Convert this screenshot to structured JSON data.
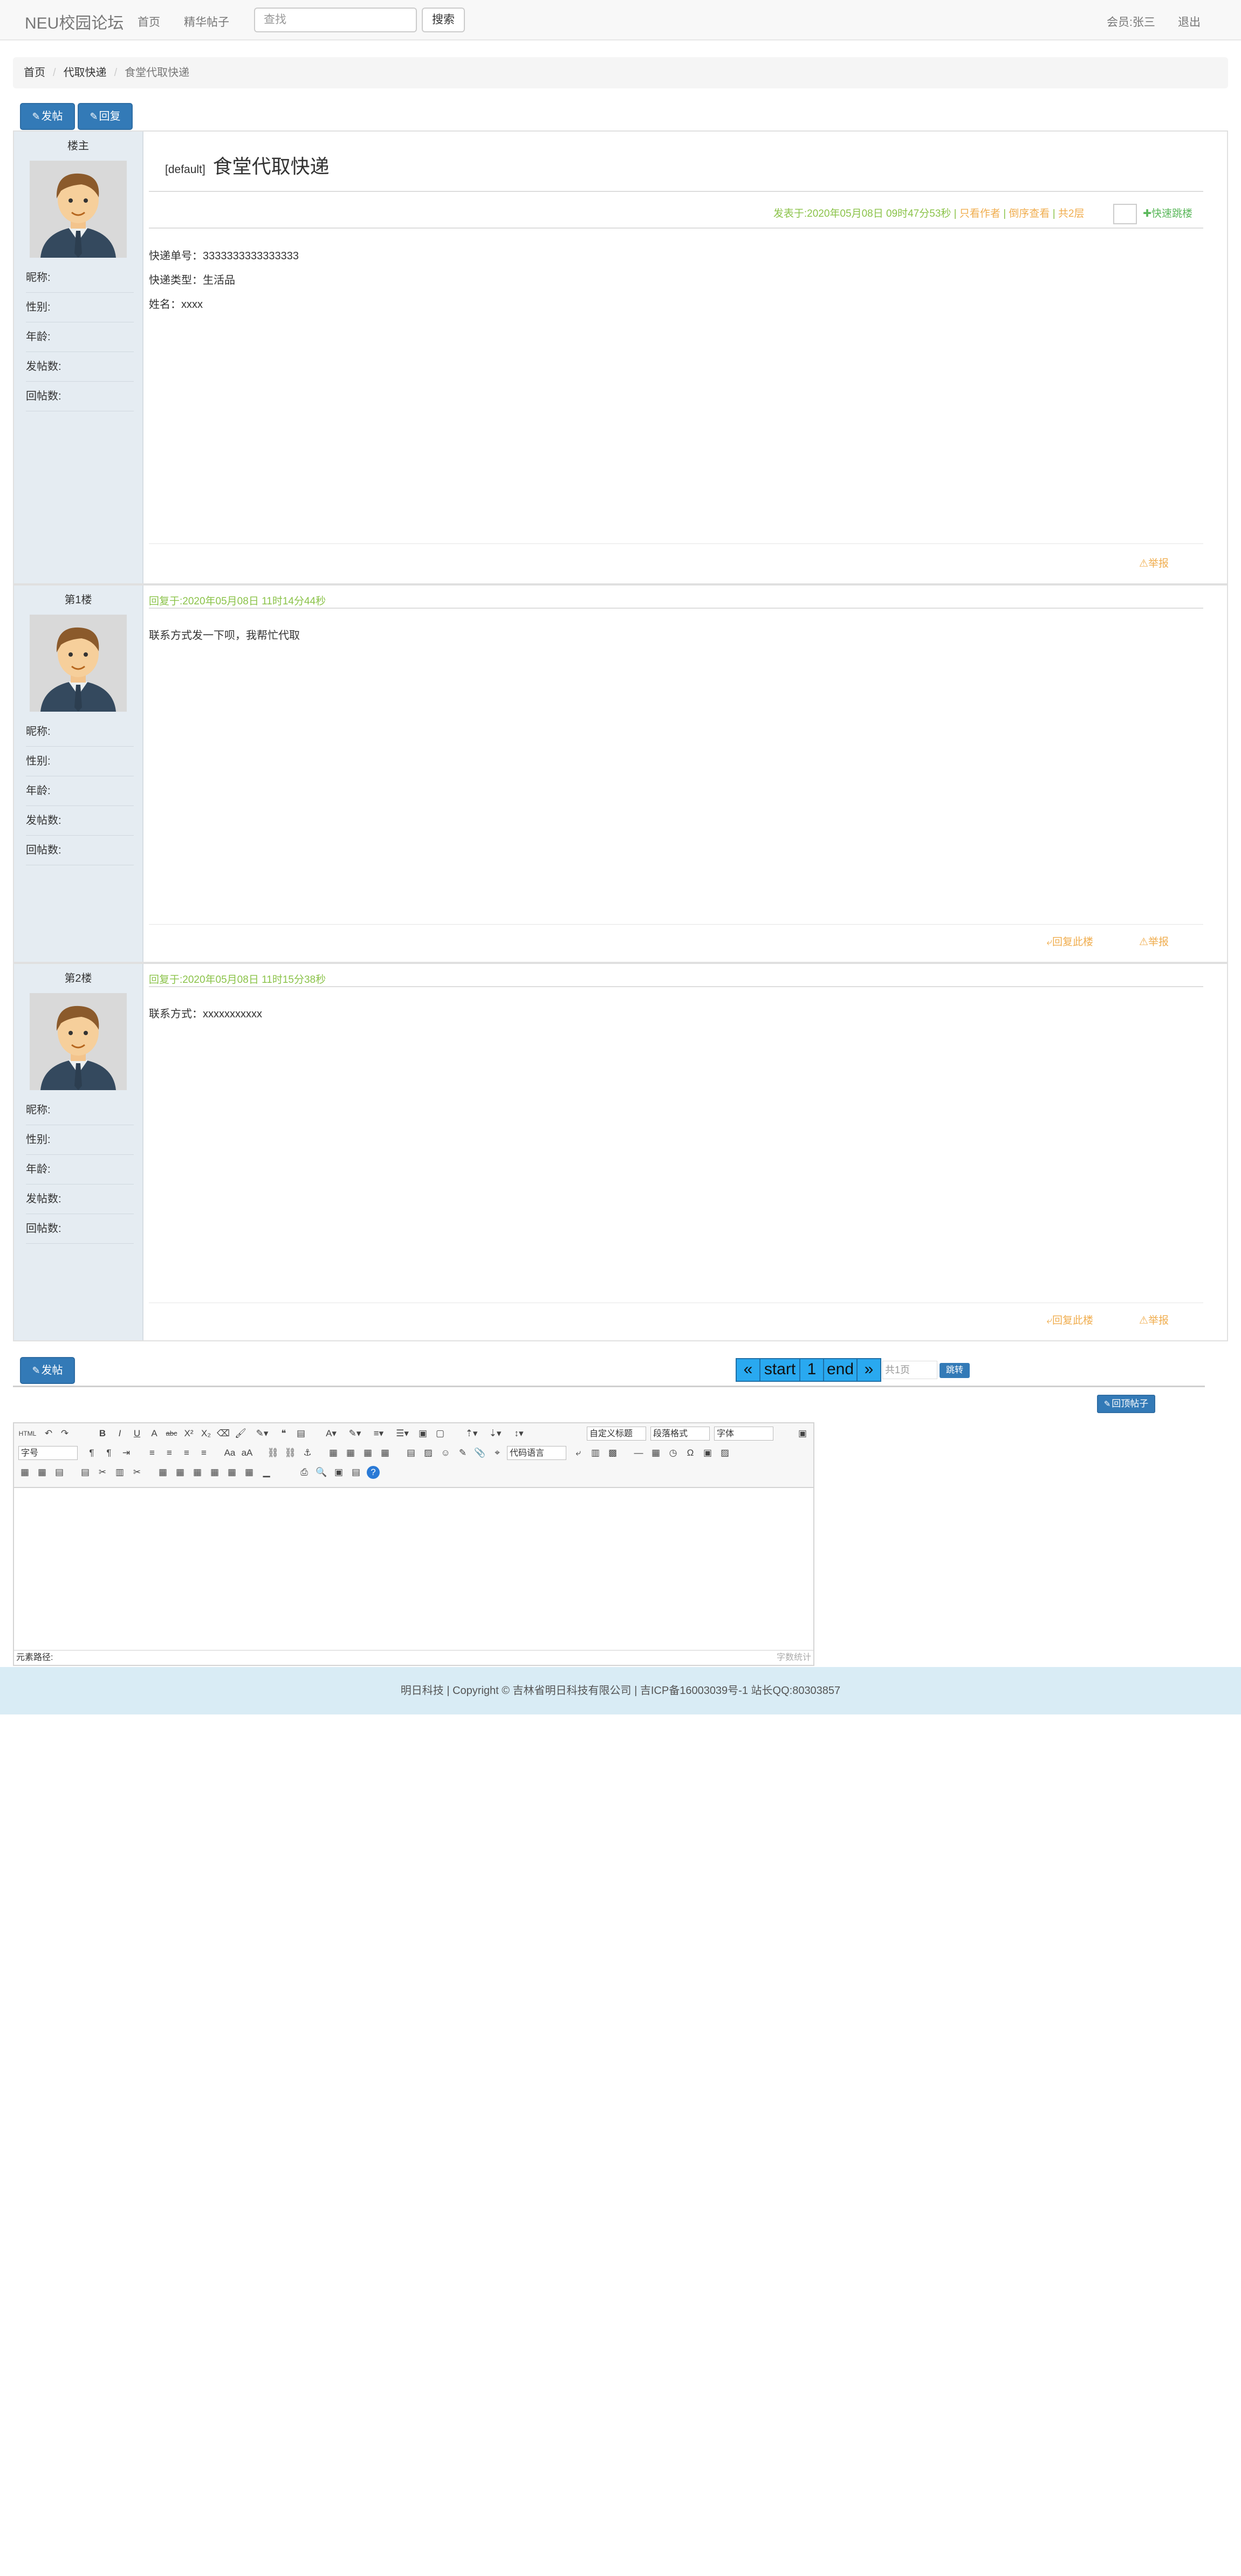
{
  "nav": {
    "brand": "NEU校园论坛",
    "home": "首页",
    "featured": "精华帖子",
    "search_placeholder": "查找",
    "search_button": "搜索",
    "member": "会员:张三",
    "logout": "退出"
  },
  "breadcrumb": [
    "首页",
    "代取快递",
    "食堂代取快递"
  ],
  "buttons": {
    "post": "发帖",
    "reply": "回复",
    "back_to_top": "回顶帖子"
  },
  "thread": {
    "tag": "[default]",
    "title": "食堂代取快递",
    "meta": {
      "posted": "发表于:2020年05月08日 09时47分53秒",
      "sep": "|",
      "only_author": "只看作者",
      "reverse": "倒序查看",
      "total": "共2层",
      "jump": "快速跳楼"
    },
    "body": [
      "快递单号：3333333333333333",
      "快递类型：生活品",
      "姓名：xxxx"
    ],
    "report": "举报"
  },
  "replies": [
    {
      "floor": "第1楼",
      "time": "回复于:2020年05月08日 11时14分44秒",
      "text": "联系方式发一下呗，我帮忙代取",
      "reply": "回复此楼",
      "report": "举报"
    },
    {
      "floor": "第2楼",
      "time": "回复于:2020年05月08日 11时15分38秒",
      "text": "联系方式：xxxxxxxxxxx",
      "reply": "回复此楼",
      "report": "举报"
    }
  ],
  "owner_floor": "楼主",
  "user_fields": [
    "昵称:",
    "性别:",
    "年龄:",
    "发帖数:",
    "回帖数:"
  ],
  "pager": {
    "prev": "«",
    "start": "start",
    "page": "1",
    "end": "end",
    "next": "»",
    "total": "共1页",
    "go": "跳转"
  },
  "editor": {
    "selects": [
      "自定义标题",
      "段落格式",
      "字体",
      "字号",
      "代码语言"
    ],
    "status_path": "元素路径:",
    "word_count": "字数统计"
  },
  "footer": "明日科技 | Copyright © 吉林省明日科技有限公司 | 吉ICP备16003039号-1 站长QQ:80303857",
  "colors": {
    "primary": "#337ab7",
    "meta_green": "#8bc34a",
    "link_orange": "#f0ad4e",
    "sidebar": "#e5ecf2"
  }
}
